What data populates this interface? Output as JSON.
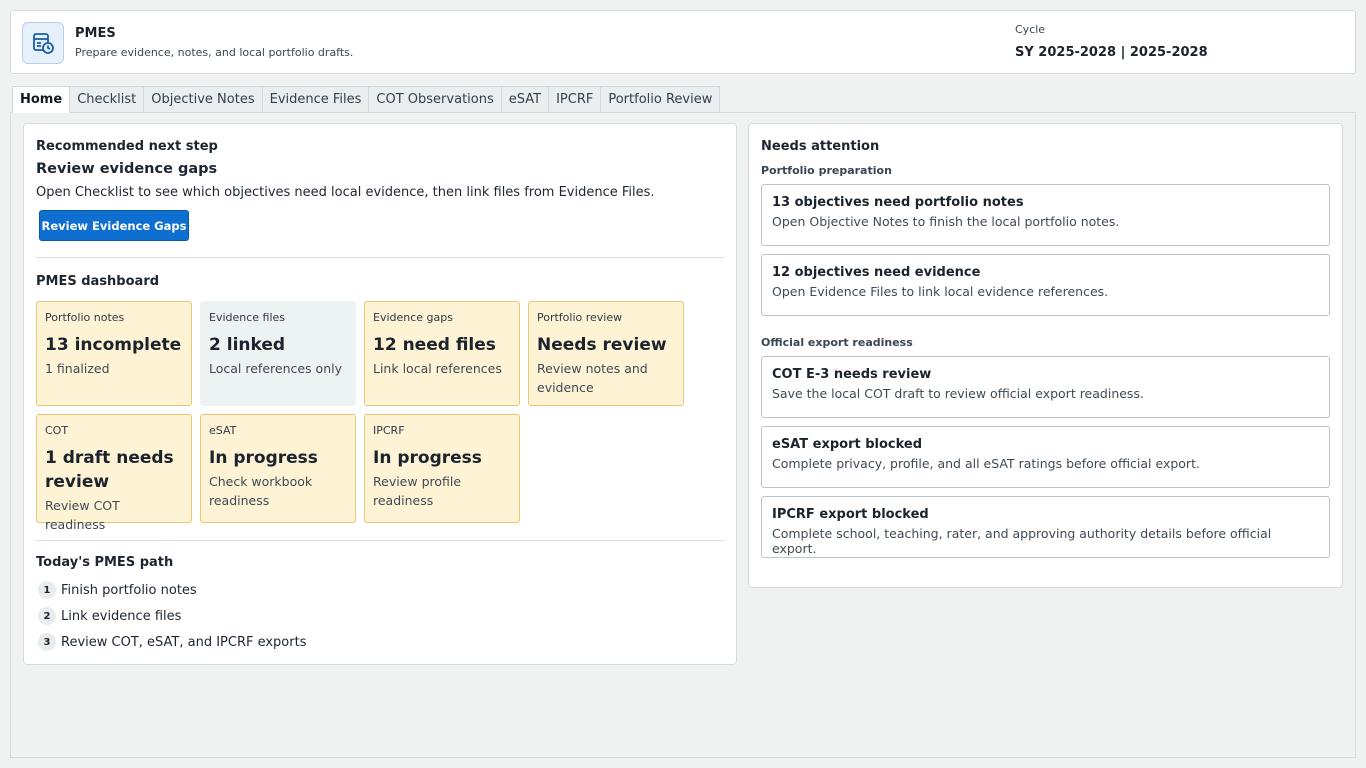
{
  "header": {
    "app_title": "PMES",
    "app_subtitle": "Prepare evidence, notes, and local portfolio drafts.",
    "cycle_label": "Cycle",
    "cycle_value": "SY 2025-2028 | 2025-2028",
    "icon": "calendar-clock-icon"
  },
  "tabs": [
    {
      "label": "Home",
      "active": true
    },
    {
      "label": "Checklist"
    },
    {
      "label": "Objective Notes"
    },
    {
      "label": "Evidence Files"
    },
    {
      "label": "COT Observations"
    },
    {
      "label": "eSAT"
    },
    {
      "label": "IPCRF"
    },
    {
      "label": "Portfolio Review"
    }
  ],
  "recommended": {
    "heading": "Recommended next step",
    "title": "Review evidence gaps",
    "description": "Open Checklist to see which objectives need local evidence, then link files from Evidence Files.",
    "button_label": "Review Evidence Gaps"
  },
  "dashboard": {
    "heading": "PMES dashboard",
    "cards": [
      {
        "label": "Portfolio notes",
        "value": "13 incomplete",
        "sub": "1 finalized",
        "status": "warning"
      },
      {
        "label": "Evidence files",
        "value": "2 linked",
        "sub": "Local references only",
        "status": "neutral"
      },
      {
        "label": "Evidence gaps",
        "value": "12 need files",
        "sub": "Link local references",
        "status": "warning"
      },
      {
        "label": "Portfolio review",
        "value": "Needs review",
        "sub": "Review notes and evidence",
        "status": "warning"
      },
      {
        "label": "COT",
        "value": "1 draft needs review",
        "sub": "Review COT readiness",
        "status": "warning"
      },
      {
        "label": "eSAT",
        "value": "In progress",
        "sub": "Check workbook readiness",
        "status": "warning"
      },
      {
        "label": "IPCRF",
        "value": "In progress",
        "sub": "Review profile readiness",
        "status": "warning"
      }
    ]
  },
  "path": {
    "heading": "Today's PMES path",
    "steps": [
      {
        "num": "1",
        "label": "Finish portfolio notes"
      },
      {
        "num": "2",
        "label": "Link evidence files"
      },
      {
        "num": "3",
        "label": "Review COT, eSAT, and IPCRF exports"
      }
    ]
  },
  "attention": {
    "heading": "Needs attention",
    "groups": [
      {
        "label": "Portfolio preparation",
        "items": [
          {
            "title": "13 objectives need portfolio notes",
            "desc": "Open Objective Notes to finish the local portfolio notes."
          },
          {
            "title": "12 objectives need evidence",
            "desc": "Open Evidence Files to link local evidence references."
          }
        ]
      },
      {
        "label": "Official export readiness",
        "items": [
          {
            "title": "COT E-3 needs review",
            "desc": "Save the local COT draft to review official export readiness."
          },
          {
            "title": "eSAT export blocked",
            "desc": "Complete privacy, profile, and all eSAT ratings before official export."
          },
          {
            "title": "IPCRF export blocked",
            "desc": "Complete school, teaching, rater, and approving authority details before official export."
          }
        ]
      }
    ]
  },
  "colors": {
    "accent": "#0f6fd0",
    "warning_bg": "#fff3d6",
    "warning_border": "#e8c874",
    "neutral_bg": "#edf2f2"
  }
}
